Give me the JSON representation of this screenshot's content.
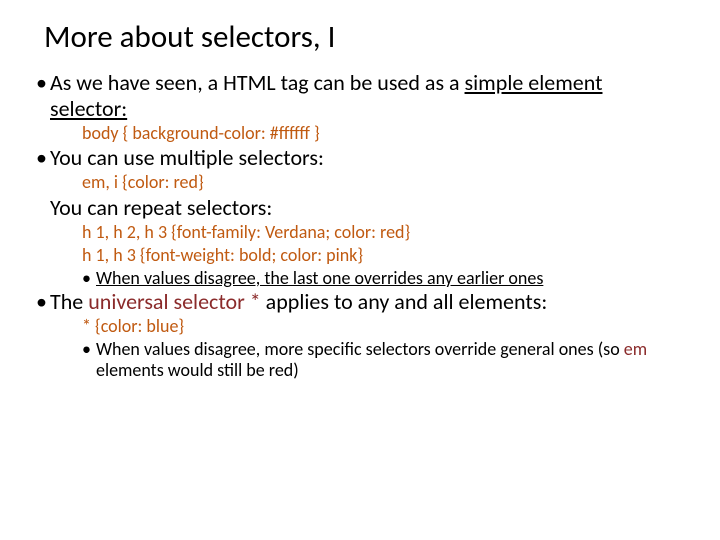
{
  "title": "More about selectors, I",
  "p1a": "As we have seen, a HTML tag can be used as a ",
  "p1b": "simple element selector:",
  "code1": "body { background-color: #ffffff }",
  "p2": "You can use multiple selectors:",
  "code2": "em, i {color: red}",
  "p3": "You can repeat selectors:",
  "code3a": "h 1, h 2, h 3 {font-family: Verdana; color: red}",
  "code3b": "h 1, h 3 {font-weight: bold; color: pink}",
  "note1": "When values disagree, the last one overrides any earlier ones",
  "p4a": "The ",
  "p4b": "universal selector *",
  "p4c": " applies to any and all elements:",
  "code4": "* {color: blue}",
  "note2a": "When values disagree, more specific selectors override general ones (so ",
  "note2b": "em",
  "note2c": " elements would still be red)"
}
